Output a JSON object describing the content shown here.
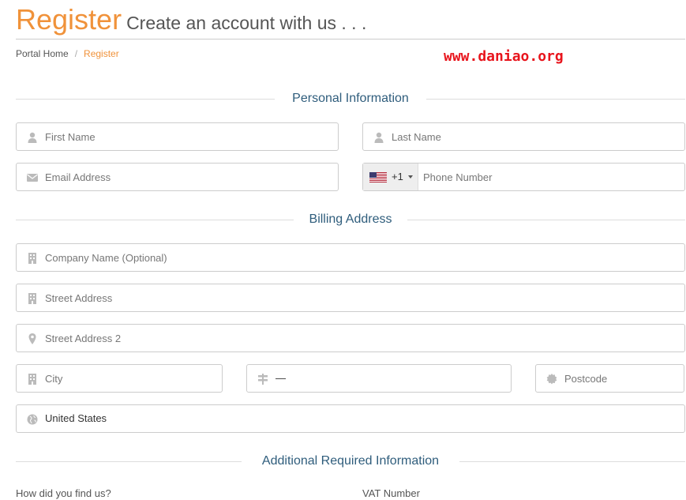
{
  "header": {
    "title": "Register",
    "subtitle": "Create an account with us . . ."
  },
  "breadcrumb": {
    "home": "Portal Home",
    "separator": "/",
    "current": "Register"
  },
  "watermark": "www.daniao.org",
  "sections": {
    "personal": "Personal Information",
    "billing": "Billing Address",
    "additional": "Additional Required Information"
  },
  "fields": {
    "first_name": {
      "placeholder": "First Name",
      "icon": "user-icon"
    },
    "last_name": {
      "placeholder": "Last Name",
      "icon": "user-icon"
    },
    "email": {
      "placeholder": "Email Address",
      "icon": "envelope-icon"
    },
    "phone": {
      "placeholder": "Phone Number",
      "dial_code": "+1",
      "flag": "us-flag-icon"
    },
    "company": {
      "placeholder": "Company Name (Optional)",
      "icon": "building-icon"
    },
    "street1": {
      "placeholder": "Street Address",
      "icon": "building-icon"
    },
    "street2": {
      "placeholder": "Street Address 2",
      "icon": "map-marker-icon"
    },
    "city": {
      "placeholder": "City",
      "icon": "building-icon"
    },
    "state": {
      "value": "—",
      "icon": "signpost-icon"
    },
    "postcode": {
      "placeholder": "Postcode",
      "icon": "certificate-icon"
    },
    "country": {
      "value": "United States",
      "icon": "globe-icon"
    }
  },
  "additional_labels": {
    "how_found": "How did you find us?",
    "vat": "VAT Number"
  },
  "colors": {
    "accent": "#f0923a",
    "section": "#2f5d7c",
    "border": "#cccccc",
    "watermark": "#e8141c"
  }
}
